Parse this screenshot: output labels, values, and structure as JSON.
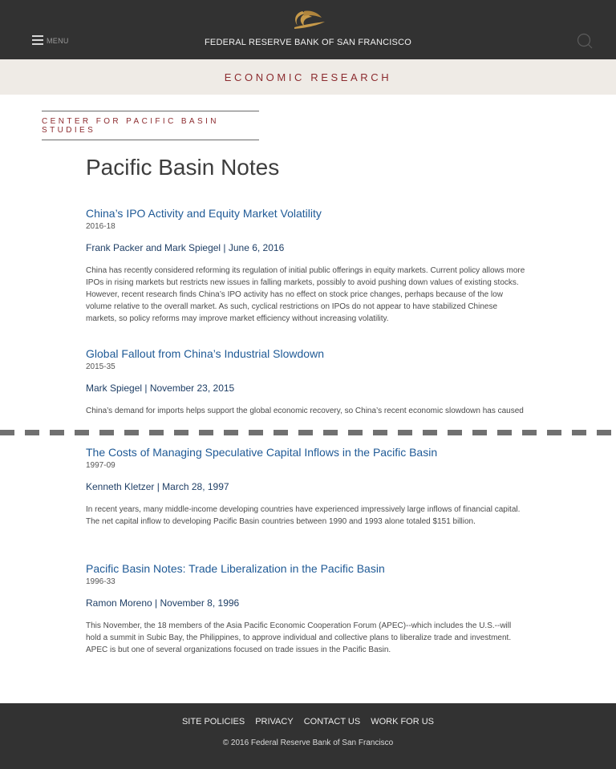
{
  "header": {
    "menu_label": "MENU",
    "site_title": "FEDERAL RESERVE BANK OF SAN FRANCISCO",
    "logo_icon": "fed-eagle-logo-icon",
    "accent_gold": "#c79a4a"
  },
  "section": {
    "title": "ECONOMIC RESEARCH"
  },
  "center": {
    "title": "CENTER FOR PACIFIC BASIN STUDIES"
  },
  "page": {
    "title": "Pacific Basin Notes"
  },
  "articles": [
    {
      "title": "China’s IPO Activity and Equity Market Volatility",
      "id": "2016-18",
      "byline": "Frank Packer and Mark Spiegel | June 6, 2016",
      "summary": "China has recently considered reforming its regulation of initial public offerings in equity markets. Current policy allows more IPOs in rising markets but restricts new issues in falling markets, possibly to avoid pushing down values of existing stocks. However, recent research finds China’s IPO activity has no effect on stock price changes, perhaps because of the low volume relative to the overall market. As such, cyclical restrictions on IPOs do not appear to have stabilized Chinese markets, so policy reforms may improve market efficiency without increasing volatility."
    },
    {
      "title": "Global Fallout from China’s Industrial Slowdown",
      "id": "2015-35",
      "byline": "Mark Spiegel | November 23, 2015",
      "summary": "China’s demand for imports helps support the global economic recovery, so China’s recent economic slowdown has caused international concern. China’s slowdown is concentrated in the industrial sector, while its emerging service"
    },
    {
      "title": "The Costs of Managing Speculative Capital Inflows in the Pacific Basin",
      "id": "1997-09",
      "byline": "Kenneth Kletzer | March 28, 1997",
      "summary": "In recent years, many middle-income developing countries have experienced impressively large inflows of financial capital. The net capital inflow to developing Pacific Basin countries between 1990 and 1993 alone totaled $151 billion."
    },
    {
      "title": "Pacific Basin Notes: Trade Liberalization in the Pacific Basin",
      "id": "1996-33",
      "byline": "Ramon Moreno | November 8, 1996",
      "summary": "This November, the 18 members of the Asia Pacific Economic Cooperation Forum (APEC)--which includes the U.S.--will hold a summit in Subic Bay, the Philippines, to approve individual and collective plans to liberalize trade and investment. APEC is but one of several organizations focused on trade issues in the Pacific Basin."
    }
  ],
  "footer": {
    "links": [
      "SITE POLICIES",
      "PRIVACY",
      "CONTACT US",
      "WORK FOR US"
    ],
    "copyright": "© 2016 Federal Reserve Bank of San Francisco"
  }
}
